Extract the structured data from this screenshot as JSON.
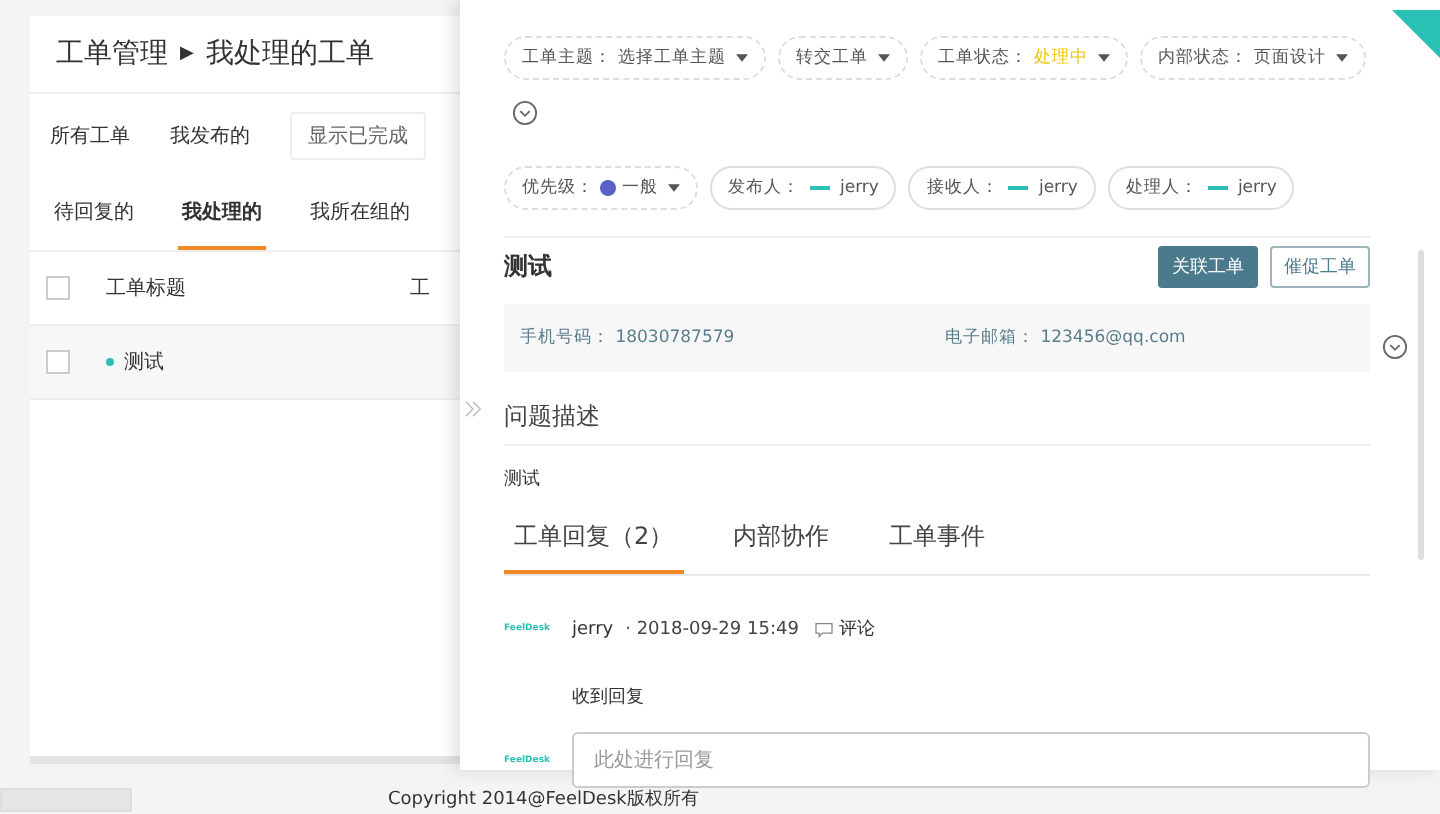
{
  "list_page": {
    "breadcrumb": {
      "section": "工单管理",
      "separator": "▶",
      "current": "我处理的工单"
    },
    "scopes": [
      {
        "label": "所有工单"
      },
      {
        "label": "我发布的"
      }
    ],
    "toggle": "显示已完成",
    "tabs": [
      {
        "label": "待回复的",
        "selected": false
      },
      {
        "label": "我处理的",
        "selected": true
      },
      {
        "label": "我所在组的",
        "selected": false
      }
    ],
    "table": {
      "all_checked": false,
      "columns": [
        "工单标题",
        "工"
      ],
      "rows": [
        {
          "title": "测试",
          "checked": false
        }
      ]
    }
  },
  "drawer": {
    "chips": [
      {
        "kind": "select",
        "label": "工单主题：",
        "value": "选择工单主题"
      },
      {
        "kind": "select",
        "label": "转交工单"
      },
      {
        "kind": "select",
        "label": "工单状态：",
        "value": "处理中",
        "color": "#f5c400"
      },
      {
        "kind": "select",
        "label": "内部状态：",
        "value": "页面设计"
      },
      {
        "kind": "priority",
        "label": "优先级：",
        "value": "一般",
        "color": "#5b5fc7"
      },
      {
        "kind": "person",
        "label": "发布人：",
        "value": "jerry"
      },
      {
        "kind": "person",
        "label": "接收人：",
        "value": "jerry"
      },
      {
        "kind": "person",
        "label": "处理人：",
        "value": "jerry"
      }
    ],
    "title": "测试",
    "buttons": [
      {
        "label": "关联工单",
        "primary": true
      },
      {
        "label": "催促工单",
        "primary": false
      }
    ],
    "contact": [
      {
        "label": "手机号码：",
        "value": "18030787579"
      },
      {
        "label": "电子邮箱：",
        "value": "123456@qq.com"
      }
    ],
    "description_heading": "问题描述",
    "description": "测试",
    "tabs": [
      {
        "label": "工单回复（2）",
        "selected": true
      },
      {
        "label": "内部协作",
        "selected": false
      },
      {
        "label": "工单事件",
        "selected": false
      }
    ],
    "replies": [
      {
        "logo": "FeelDesk",
        "author": "jerry",
        "time": "· 2018-09-29 15:49",
        "action": "评论",
        "body": "收到回复"
      }
    ],
    "reply_box": {
      "logo": "FeelDesk",
      "placeholder": "此处进行回复"
    }
  },
  "footer": "Copyright 2014@FeelDesk版权所有"
}
